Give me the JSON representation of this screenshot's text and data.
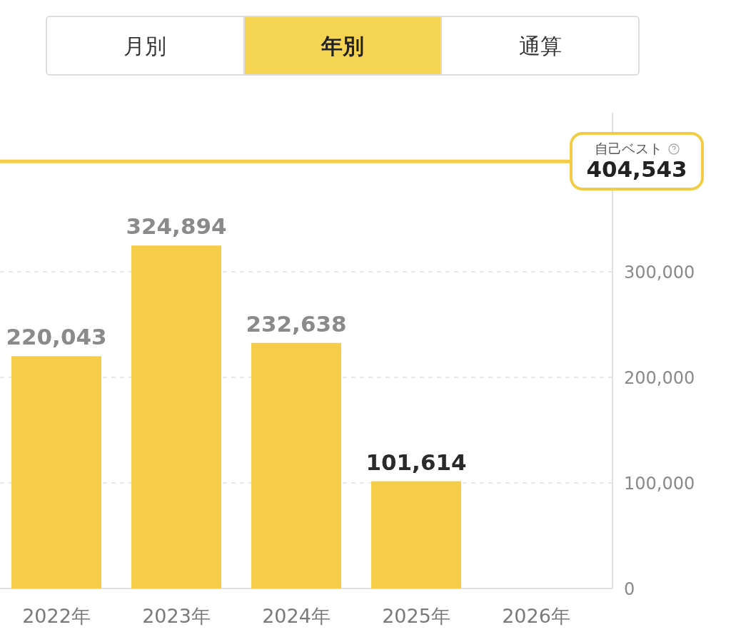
{
  "tabs": [
    {
      "label": "月別",
      "selected": false
    },
    {
      "label": "年別",
      "selected": true
    },
    {
      "label": "通算",
      "selected": false
    }
  ],
  "chart": {
    "chart_data": {
      "type": "bar",
      "categories": [
        "2022年",
        "2023年",
        "2024年",
        "2025年",
        "2026年"
      ],
      "series": [
        {
          "color": "#f5cd48",
          "values": [
            220043,
            324894,
            232638,
            101614,
            null
          ]
        }
      ],
      "ylim": [
        0,
        450000
      ],
      "yticks": [
        {
          "value": 0,
          "label": "0"
        },
        {
          "value": 100000,
          "label": "100,000"
        },
        {
          "value": 200000,
          "label": "200,000"
        },
        {
          "value": 300000,
          "label": "300,000"
        }
      ],
      "grid": true,
      "value_labels": [
        "220,043",
        "324,894",
        "232,638",
        "101,614",
        null
      ],
      "ref_lines": [
        {
          "axis": "y",
          "value": 404543,
          "label": "404,543"
        }
      ]
    },
    "bars": [
      {
        "current": false
      },
      {
        "current": false
      },
      {
        "current": false
      },
      {
        "current": true
      }
    ],
    "personal_best": {
      "label": "自己ベスト"
    }
  }
}
